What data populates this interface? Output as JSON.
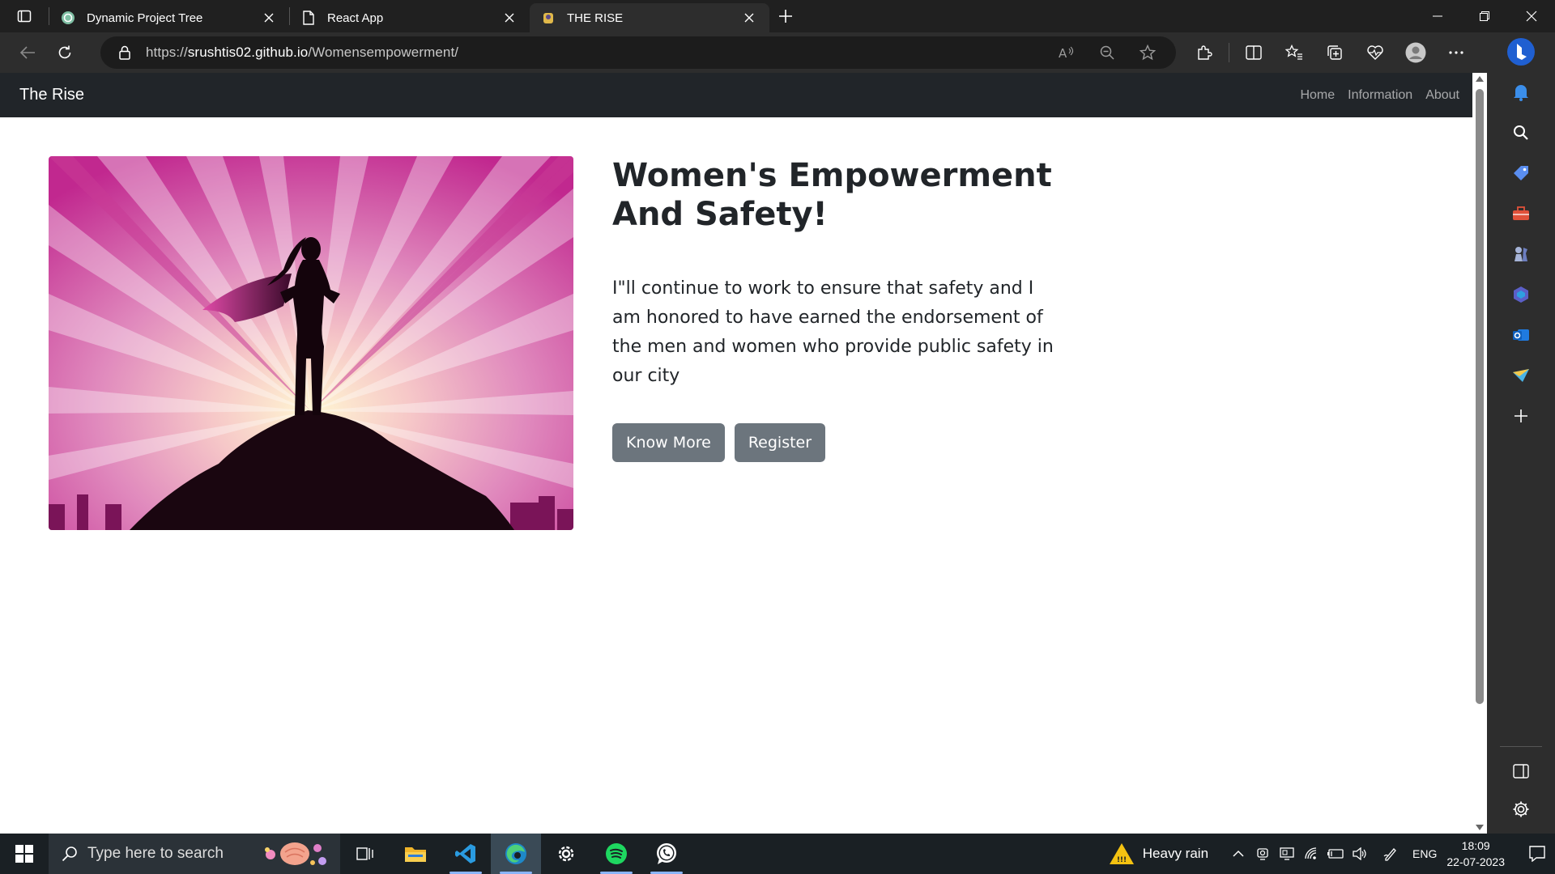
{
  "browser": {
    "tabs": [
      {
        "title": "Dynamic Project Tree",
        "icon": "chatgpt-icon",
        "active": false
      },
      {
        "title": "React App",
        "icon": "page-icon",
        "active": false
      },
      {
        "title": "THE RISE",
        "icon": "site-icon",
        "active": true
      }
    ],
    "address": {
      "scheme": "https://",
      "host": "srushtis02.github.io",
      "path": "/Womensempowerment/"
    }
  },
  "site": {
    "brand": "The Rise",
    "nav": [
      "Home",
      "Information",
      "About"
    ],
    "hero": {
      "title": "Women's Empowerment And Safety!",
      "description": "I\"ll continue to work to ensure that safety and I am honored to have earned the endorsement of the men and women who provide public safety in our city",
      "buttons": [
        "Know More",
        "Register"
      ]
    }
  },
  "taskbar": {
    "search_placeholder": "Type here to search",
    "apps": [
      "task-view-icon",
      "file-explorer-icon",
      "vscode-icon",
      "edge-icon",
      "settings-icon",
      "spotify-icon",
      "whatsapp-icon"
    ],
    "weather": "Heavy rain",
    "language": "ENG",
    "time": "18:09",
    "date": "22-07-2023"
  }
}
